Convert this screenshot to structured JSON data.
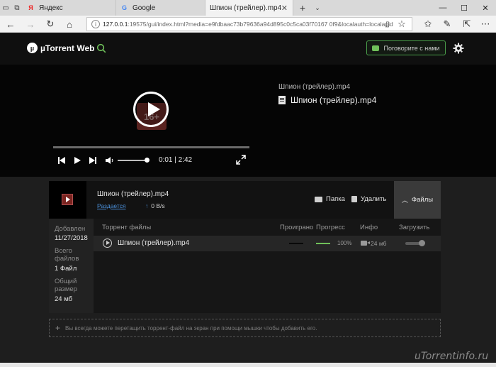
{
  "browser": {
    "tabs": [
      {
        "title": "Яндекс",
        "favicon": "Я",
        "active": false
      },
      {
        "title": "Google",
        "favicon": "G",
        "active": false
      },
      {
        "title": "Шпион (трейлер).mp4",
        "active": true
      }
    ],
    "url_host": "127.0.0.1",
    "url_rest": ":19575/gui/index.html?media=e9fdbaac73b79636a94d895c0c5ca03f70167 0f9&localauth=localapid"
  },
  "app": {
    "brand": "µTorrent Web",
    "chat_button": "Поговорите с нами",
    "accent_color": "#6fc05a"
  },
  "player": {
    "time_current": "0:01",
    "time_total": "2:42",
    "volume": 0.9,
    "title_small": "Шпион (трейлер).mp4",
    "title_big": "Шпион (трейлер).mp4",
    "poster_label": "16+"
  },
  "torrent": {
    "name": "Шпион (трейлер).mp4",
    "status": "Раздается",
    "upload_speed": "0 B/s",
    "folder_label": "Папка",
    "delete_label": "Удалить",
    "files_label": "Файлы"
  },
  "details": {
    "added_label": "Добавлен",
    "added_value": "11/27/2018",
    "total_files_label": "Всего файлов",
    "total_files_value": "1 Файл",
    "total_size_label": "Общий размер",
    "total_size_value": "24 мб"
  },
  "files_table": {
    "columns": [
      "Торрент файлы",
      "Проиграно",
      "Прогресс",
      "Инфо",
      "Загрузить"
    ],
    "rows": [
      {
        "name": "Шпион (трейлер).mp4",
        "progress": 1.0,
        "progress_text": "100%",
        "size": "24 мб"
      }
    ]
  },
  "dropzone_text": "Вы всегда можете перетащить торрент-файл на экран при помощи мышки чтобы добавить его.",
  "watermark": "uTorrentinfo.ru"
}
